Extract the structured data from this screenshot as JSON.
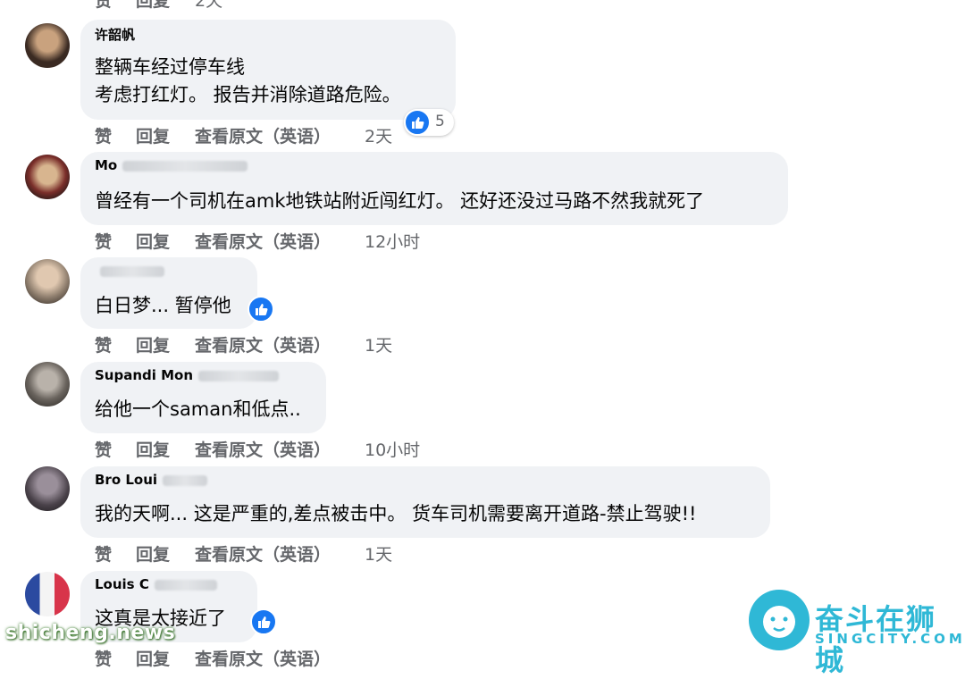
{
  "top_actions": {
    "like": "赞",
    "reply": "回复",
    "time": "2天"
  },
  "comments": [
    {
      "author": "许韶帆",
      "lines": [
        "整辆车经过停车线",
        "考虑打红灯。 报告并消除道路危险。"
      ],
      "like": "赞",
      "reply": "回复",
      "see_original": "查看原文（英语）",
      "time": "2天",
      "reaction_count": "5"
    },
    {
      "author": "Mo",
      "lines": [
        "曾经有一个司机在amk地铁站附近闯红灯。 还好还没过马路不然我就死了"
      ],
      "like": "赞",
      "reply": "回复",
      "see_original": "查看原文（英语）",
      "time": "12小时"
    },
    {
      "author": "",
      "lines": [
        "白日梦... 暂停他"
      ],
      "like": "赞",
      "reply": "回复",
      "see_original": "查看原文（英语）",
      "time": "1天"
    },
    {
      "author": "Supandi Mon",
      "lines": [
        "给他一个saman和低点.."
      ],
      "like": "赞",
      "reply": "回复",
      "see_original": "查看原文（英语）",
      "time": "10小时"
    },
    {
      "author": "Bro Loui",
      "lines": [
        "我的天啊... 这是严重的,差点被击中。 货车司机需要离开道路-禁止驾驶!!"
      ],
      "like": "赞",
      "reply": "回复",
      "see_original": "查看原文（英语）",
      "time": "1天"
    },
    {
      "author": "Louis C",
      "lines": [
        "这真是太接近了"
      ],
      "like": "赞",
      "reply": "回复",
      "see_original": "查看原文（英语）",
      "time": ""
    }
  ],
  "watermarks": {
    "left": "shicheng.news",
    "brand": "奋斗在狮城",
    "brand_sub": "SINGCITY.COM"
  },
  "colors": {
    "bubble": "#f0f2f5",
    "like_blue": "#1877f2",
    "action_gray": "#65676b",
    "brand": "#2fb8d6"
  }
}
